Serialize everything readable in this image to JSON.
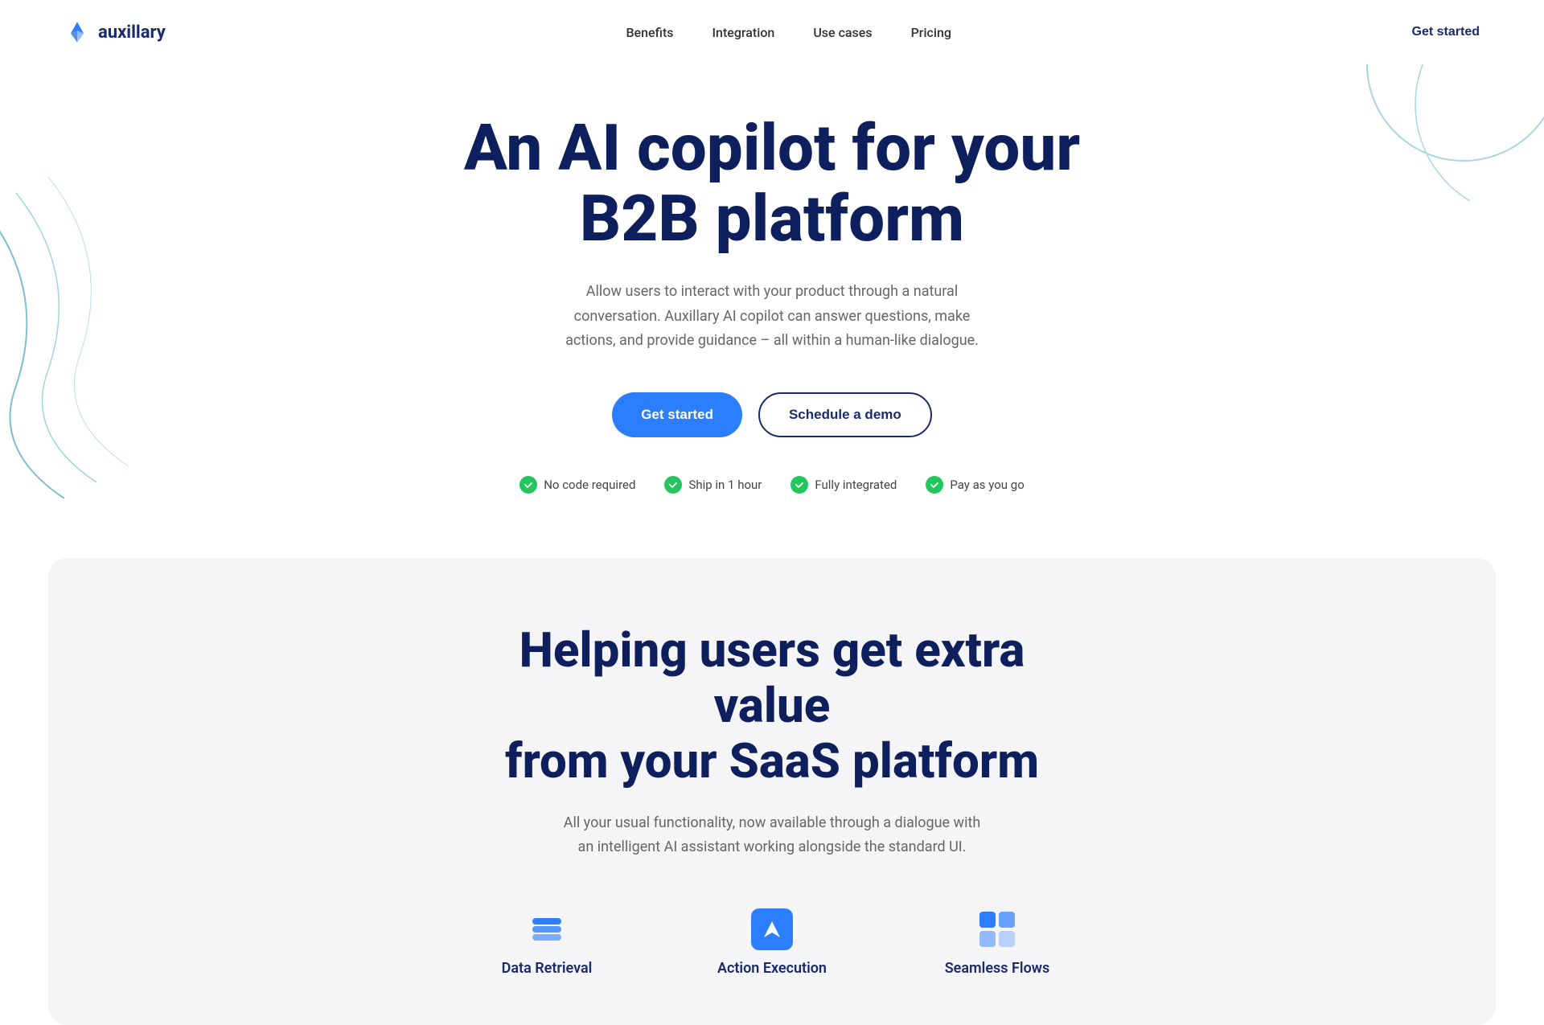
{
  "nav": {
    "logo_text": "auxillary",
    "links": [
      {
        "label": "Benefits",
        "id": "benefits"
      },
      {
        "label": "Integration",
        "id": "integration"
      },
      {
        "label": "Use cases",
        "id": "use-cases"
      },
      {
        "label": "Pricing",
        "id": "pricing"
      }
    ],
    "cta_label": "Get started"
  },
  "hero": {
    "title_line1": "An AI copilot for your",
    "title_line2": "B2B platform",
    "subtitle": "Allow users to interact with your product through a natural conversation. Auxillary AI copilot can answer questions, make actions, and provide guidance – all within a human-like dialogue.",
    "btn_primary": "Get started",
    "btn_outline": "Schedule a demo",
    "badges": [
      {
        "label": "No code required"
      },
      {
        "label": "Ship in 1 hour"
      },
      {
        "label": "Fully integrated"
      },
      {
        "label": "Pay as you go"
      }
    ]
  },
  "second_section": {
    "title_line1": "Helping users get extra value",
    "title_line2": "from your SaaS platform",
    "subtitle": "All your usual functionality, now available through a dialogue with an intelligent AI assistant working alongside the standard UI.",
    "features": [
      {
        "label": "Data Retrieval",
        "icon": "database"
      },
      {
        "label": "Action Execution",
        "icon": "send"
      },
      {
        "label": "Seamless Flows",
        "icon": "flows"
      }
    ]
  }
}
